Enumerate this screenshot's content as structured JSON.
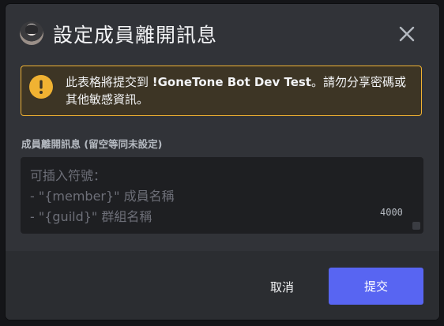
{
  "modal": {
    "title": "設定成員離開訊息",
    "close_icon": "close-icon"
  },
  "warning": {
    "icon": "exclamation-circle-icon",
    "prefix": "此表格將提交到 ",
    "bot_name": "!GoneTone Bot Dev Test",
    "suffix": "。請勿分享密碼或其他敏感資訊。"
  },
  "field": {
    "label": "成員離開訊息 (留空等同未設定)",
    "placeholder_lines": [
      "可插入符號：",
      "- \"{member}\" 成員名稱",
      "- \"{guild}\" 群組名稱"
    ],
    "char_limit": "4000"
  },
  "footer": {
    "cancel_label": "取消",
    "submit_label": "提交"
  },
  "colors": {
    "accent": "#5865f2",
    "warning": "#f0b232",
    "modal_bg": "#313338",
    "footer_bg": "#2b2d31"
  }
}
